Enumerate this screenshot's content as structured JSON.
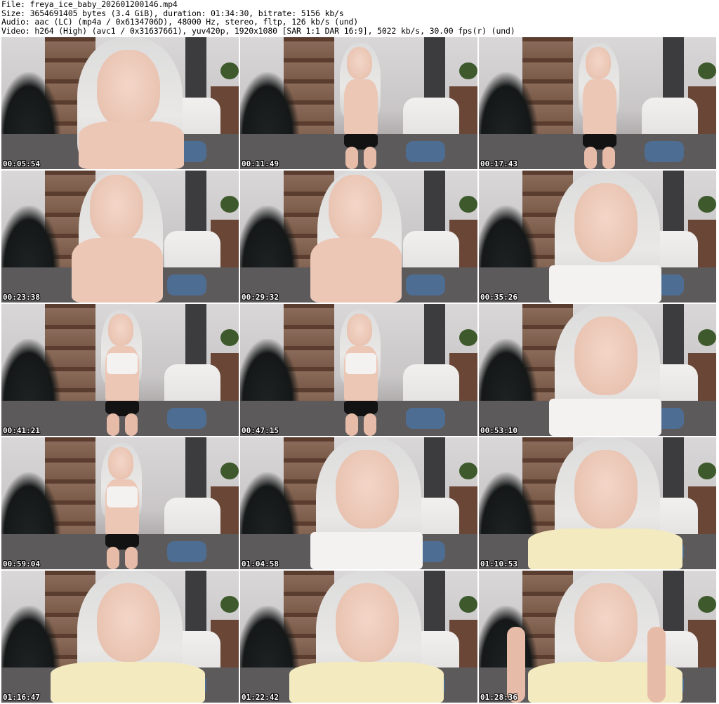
{
  "header": {
    "file_line": "File: freya_ice_baby_202601200146.mp4",
    "size_line": "Size: 3654691405 bytes (3.4 GiB), duration: 01:34:30, bitrate: 5156 kb/s",
    "audio_line": "Audio: aac (LC) (mp4a / 0x6134706D), 48000 Hz, stereo, fltp, 126 kb/s (und)",
    "video_line": "Video: h264 (High) (avc1 / 0x31637661), yuv420p, 1920x1080 [SAR 1:1 DAR 16:9], 5022 kb/s, 30.00 fps(r) (und)"
  },
  "thumbnails": [
    {
      "time": "00:05:54",
      "pose": "closeup"
    },
    {
      "time": "00:11:49",
      "pose": "standing-brief"
    },
    {
      "time": "00:17:43",
      "pose": "sitting-brief"
    },
    {
      "time": "00:23:38",
      "pose": "mid"
    },
    {
      "time": "00:29:32",
      "pose": "mid"
    },
    {
      "time": "00:35:26",
      "pose": "closeup-white"
    },
    {
      "time": "00:41:21",
      "pose": "standing-white"
    },
    {
      "time": "00:47:15",
      "pose": "standing-white"
    },
    {
      "time": "00:53:10",
      "pose": "closeup-white"
    },
    {
      "time": "00:59:04",
      "pose": "side-white"
    },
    {
      "time": "01:04:58",
      "pose": "closeup-white"
    },
    {
      "time": "01:10:53",
      "pose": "closeup-yellow"
    },
    {
      "time": "01:16:47",
      "pose": "closeup-yellow-down"
    },
    {
      "time": "01:22:42",
      "pose": "closeup-yellow"
    },
    {
      "time": "01:28:36",
      "pose": "closeup-yellow-arms"
    }
  ]
}
